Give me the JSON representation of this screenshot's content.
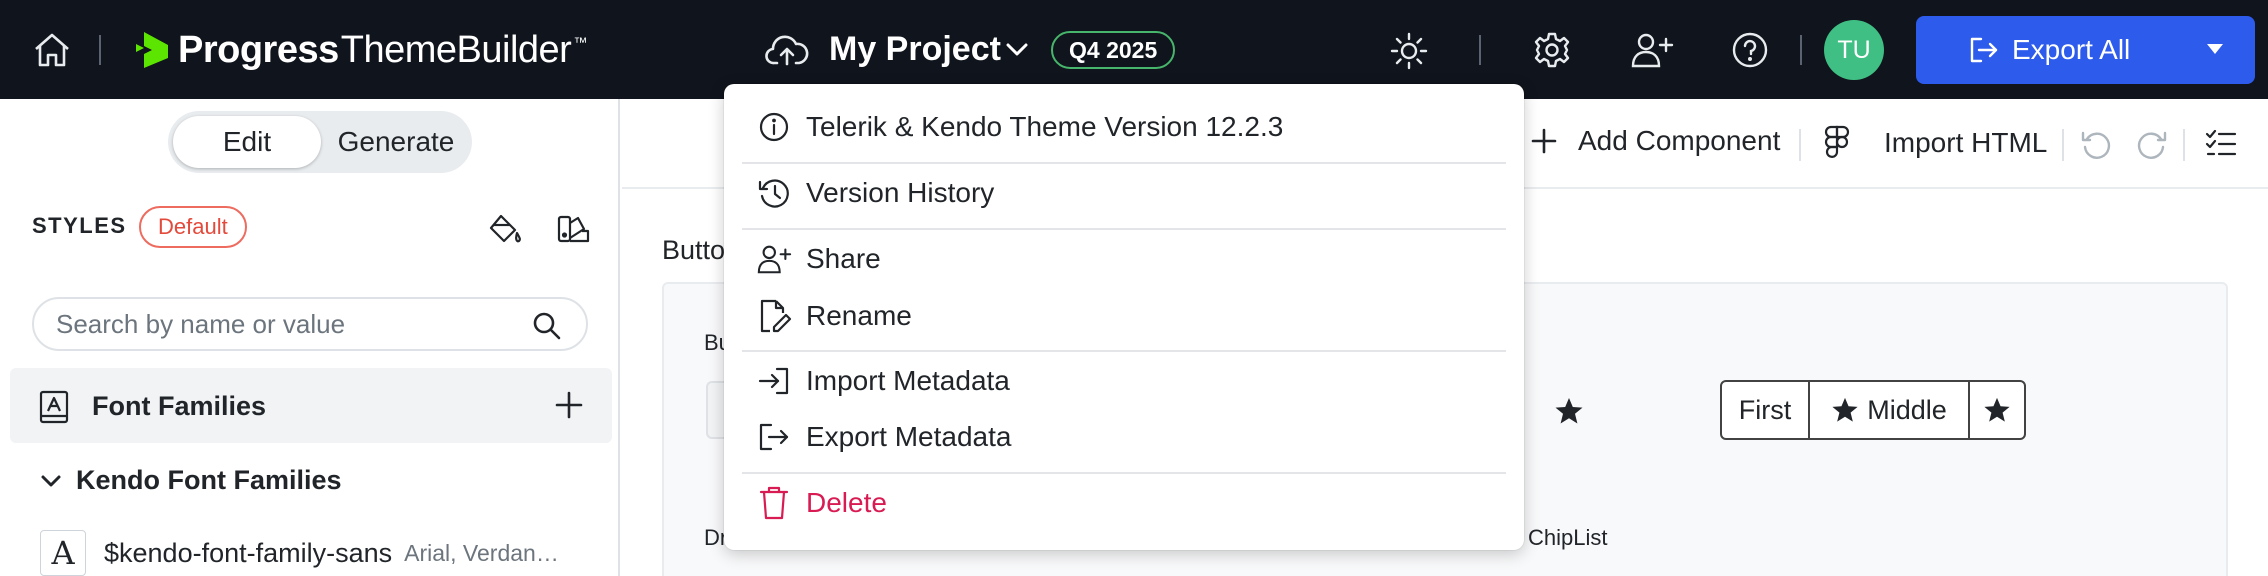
{
  "app": {
    "brand_name": "Progress",
    "brand_product": "ThemeBuilder",
    "brand_tm": "™"
  },
  "header": {
    "project_title": "My Project",
    "quarter_badge": "Q4 2025",
    "avatar_initials": "TU",
    "export_label": "Export All"
  },
  "sidebar": {
    "mode_tabs": [
      "Edit",
      "Generate"
    ],
    "active_mode": "Edit",
    "styles_label": "STYLES",
    "styles_badge": "Default",
    "search_placeholder": "Search by name or value",
    "section_label": "Font Families",
    "group_label": "Kendo Font Families",
    "font_item": {
      "glyph": "A",
      "name": "$kendo-font-family-sans",
      "value": "Arial, Verdan…"
    }
  },
  "toolbar": {
    "add_component": "Add Component",
    "import_html": "Import HTML"
  },
  "canvas": {
    "section_title_fragment": "Butto",
    "preview_label_top": "Bu",
    "preview_label_bottom_left": "Dr",
    "preview_label_chiplist": "ChipList",
    "button_group": [
      "First",
      "Middle"
    ]
  },
  "project_menu": {
    "items": [
      {
        "label": "Telerik & Kendo Theme Version 12.2.3",
        "icon": "info-icon"
      },
      {
        "label": "Version History",
        "icon": "history-icon"
      },
      {
        "label": "Share",
        "icon": "user-plus-icon"
      },
      {
        "label": "Rename",
        "icon": "file-edit-icon"
      },
      {
        "label": "Import Metadata",
        "icon": "import-icon"
      },
      {
        "label": "Export Metadata",
        "icon": "export-icon"
      },
      {
        "label": "Delete",
        "icon": "trash-icon"
      }
    ]
  },
  "colors": {
    "topbar_bg": "#10141c",
    "accent_blue": "#2d5bec",
    "badge_green": "#47b56b",
    "avatar_green": "#3fbf83",
    "default_badge_red": "#e34a3b",
    "danger": "#d81b52"
  }
}
